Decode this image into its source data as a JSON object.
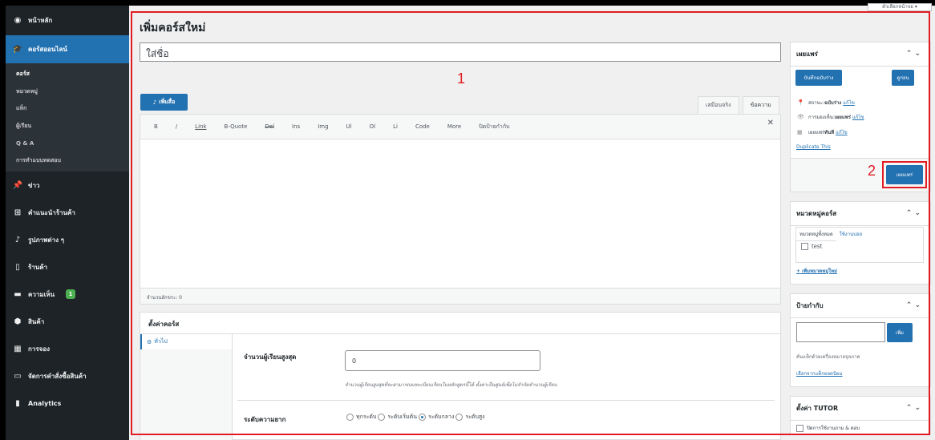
{
  "sidebar": {
    "dashboard": "หน้าหลัก",
    "courses": "คอร์สออนไลน์",
    "course_sub": [
      "คอร์ส",
      "หมวดหมู่",
      "แท็ก",
      "ผู้เรียน",
      "Q & A",
      "การทำแบบทดสอบ"
    ],
    "posts": "ข่าว",
    "store_intro": "คำแนะนำร้านค้า",
    "media": "รูปภาพต่าง ๆ",
    "products_page": "ร้านค้า",
    "comments": "ความเห็น",
    "comments_count": "1",
    "products": "สินค้า",
    "bookings": "การจอง",
    "orders": "จัดการคำสั่งซื้อสินค้า",
    "analytics": "Analytics"
  },
  "screen_options": "ตัวเลือกหน้าจอ ▾",
  "page_title": "เพิ่มคอร์สใหม่",
  "title_placeholder": "ใส่ชื่อ",
  "annotations": {
    "one": "1",
    "two": "2"
  },
  "editor": {
    "add_media": "เพิ่มสื่อ",
    "tab_visual": "เสมือนจริง",
    "tab_text": "ข้อความ",
    "quicktags": [
      "B",
      "/",
      "Link",
      "B-Quote",
      "Del",
      "Ins",
      "Img",
      "Ul",
      "Ol",
      "Li",
      "Code",
      "More",
      "ปิดป้ายกำกับ"
    ],
    "word_count": "จำนวนอักขระ: 0"
  },
  "course_settings": {
    "heading": "ตั้งค่าคอร์ส",
    "tab_general": "ทั่วไป",
    "max_students_label": "จำนวนผู้เรียนสูงสุด",
    "max_students_value": "0",
    "max_students_help": "จำนวนผู้เรียนสูงสุดที่จะสามารถลงทะเบียนเรียนในหลักสูตรนี้ได้ ตั้งค่าเป็นศูนย์เพื่อไม่จำกัดจำนวนผู้เรียน",
    "difficulty_label": "ระดับความยาก",
    "difficulty_options": [
      "ทุกระดับ",
      "ระดับเริ่มต้น",
      "ระดับกลาง",
      "ระดับสูง"
    ],
    "difficulty_selected": 2
  },
  "publish_box": {
    "title": "เผยแพร่",
    "save_draft": "บันทึกฉบับร่าง",
    "preview": "ดูก่อน",
    "status_label": "สถานะ: ",
    "status_value": "ฉบับร่าง",
    "visibility_label": "การมองเห็น: ",
    "visibility_value": "เผยแพร่",
    "schedule_label": "เผยแพร่ ",
    "schedule_value": "ทันที",
    "edit": "แก้ไข",
    "duplicate": "Duplicate This",
    "publish": "เผยแพร่"
  },
  "category_box": {
    "title": "หมวดหมู่คอร์ส",
    "tab_all": "หมวดหมู่ทั้งหมด",
    "tab_popular": "ใช้งานบ่อย",
    "items": [
      "test"
    ],
    "add_new": "+ เพิ่มหมวดหมู่ใหม่"
  },
  "tags_box": {
    "title": "ป้ายกำกับ",
    "add": "เพิ่ม",
    "hint": "คั่นแท็กด้วยเครื่องหมายจุลภาค",
    "choose": "เลือกจากแท็กยอดนิยม"
  },
  "tutor_box": {
    "title": "ตั้งค่า TUTOR",
    "option": "ปิดการใช้งานถาม & ตอบ"
  }
}
